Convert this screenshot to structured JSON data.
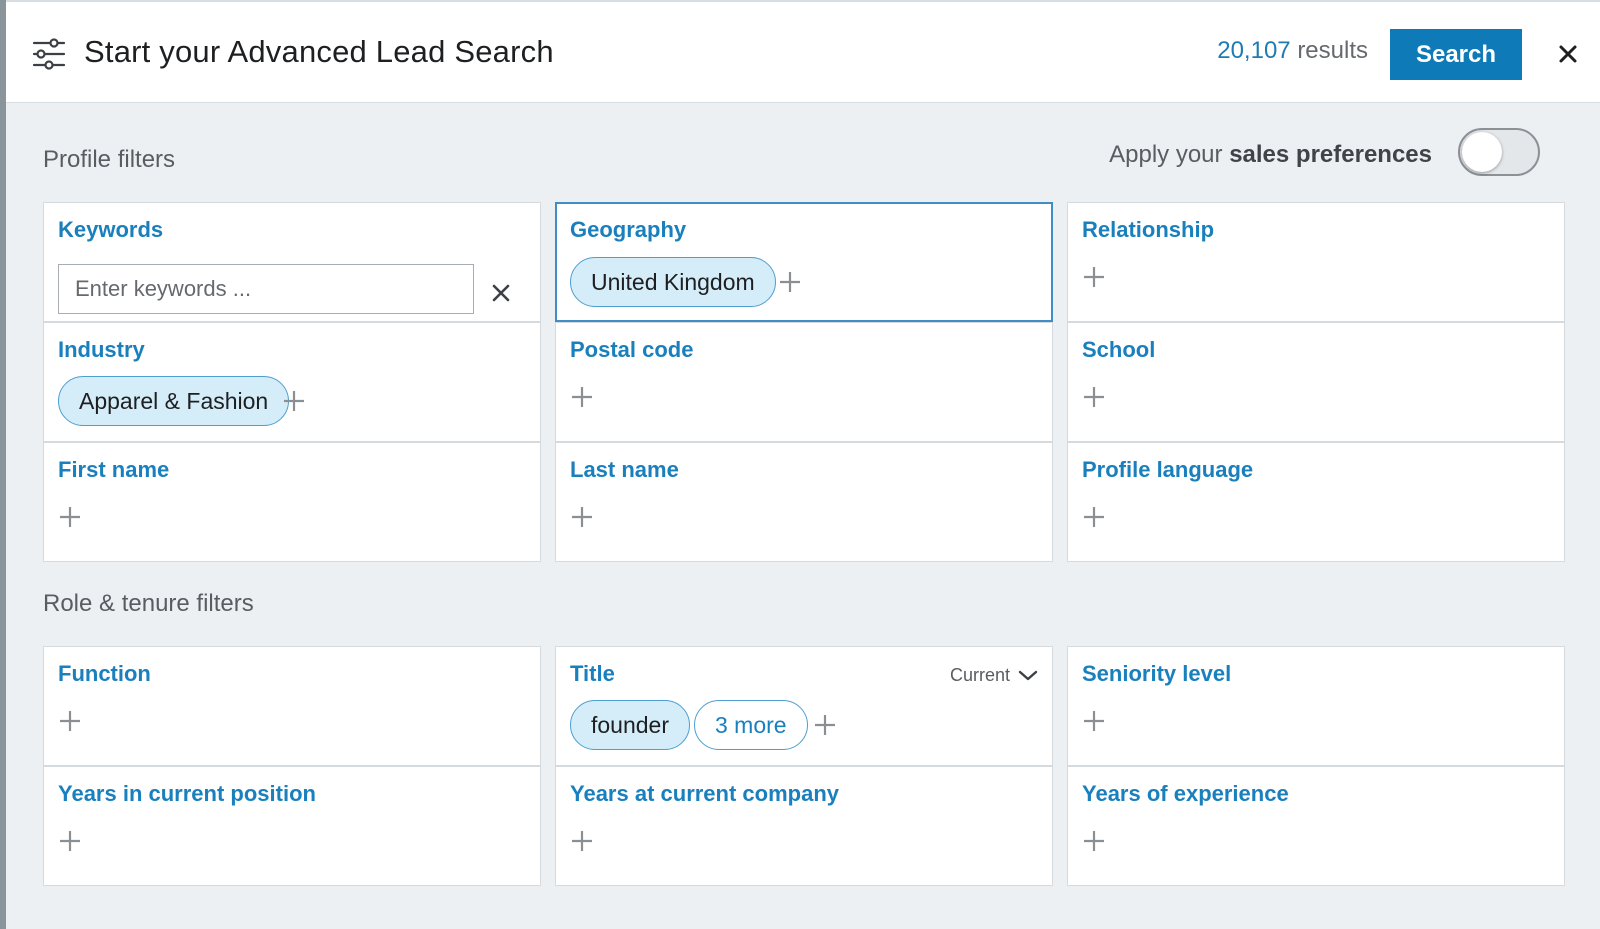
{
  "header": {
    "title": "Start your Advanced Lead Search",
    "results_count": "20,107",
    "results_suffix": "results",
    "search_label": "Search"
  },
  "profile_section": {
    "title": "Profile filters",
    "prefs_prefix": "Apply your",
    "prefs_bold": "sales preferences",
    "prefs_enabled": false
  },
  "profile_filters": {
    "keywords": {
      "label": "Keywords",
      "placeholder": "Enter keywords ..."
    },
    "geography": {
      "label": "Geography",
      "tag": "United Kingdom"
    },
    "relationship": {
      "label": "Relationship"
    },
    "industry": {
      "label": "Industry",
      "tag": "Apparel & Fashion"
    },
    "postal_code": {
      "label": "Postal code"
    },
    "school": {
      "label": "School"
    },
    "first_name": {
      "label": "First name"
    },
    "last_name": {
      "label": "Last name"
    },
    "profile_language": {
      "label": "Profile language"
    }
  },
  "role_section": {
    "title": "Role & tenure filters"
  },
  "role_filters": {
    "function": {
      "label": "Function"
    },
    "title": {
      "label": "Title",
      "dropdown": "Current",
      "tag": "founder",
      "more": "3 more"
    },
    "seniority": {
      "label": "Seniority level"
    },
    "years_position": {
      "label": "Years in current position"
    },
    "years_company": {
      "label": "Years at current company"
    },
    "years_experience": {
      "label": "Years of experience"
    }
  },
  "colors": {
    "accent": "#0f7ab8",
    "label": "#1a80bd",
    "pill_bg": "#d4edf9"
  }
}
